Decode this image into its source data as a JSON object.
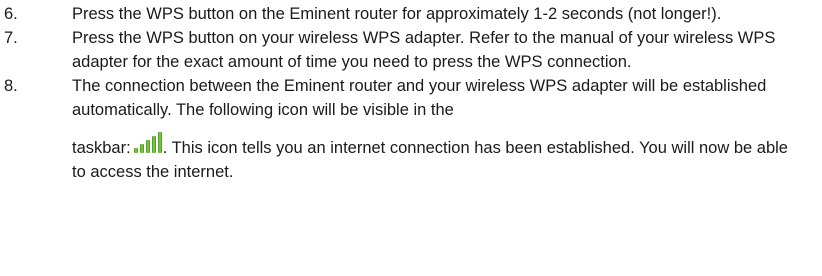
{
  "steps": [
    {
      "number": "6.",
      "text": "Press the WPS button on the Eminent router for approximately 1-2 seconds (not longer!)."
    },
    {
      "number": "7.",
      "text": "Press the WPS button on your wireless WPS adapter. Refer to the manual of your wireless WPS adapter for the exact amount of  time you need to press the WPS connection."
    },
    {
      "number": "8.",
      "text_before_break": "The connection between the Eminent router and your wireless WPS adapter will be established automatically. The following icon will be visible in the",
      "text_before_icon": "taskbar:",
      "icon": "signal-strength-icon",
      "text_after_icon": ". This icon tells you an internet connection has been established. You will now be able to access the internet."
    }
  ],
  "colors": {
    "text": "#1a1a1a",
    "signal_light": "#b9e27a",
    "signal_mid": "#7cc23a",
    "signal_dark": "#3f8f1f"
  }
}
